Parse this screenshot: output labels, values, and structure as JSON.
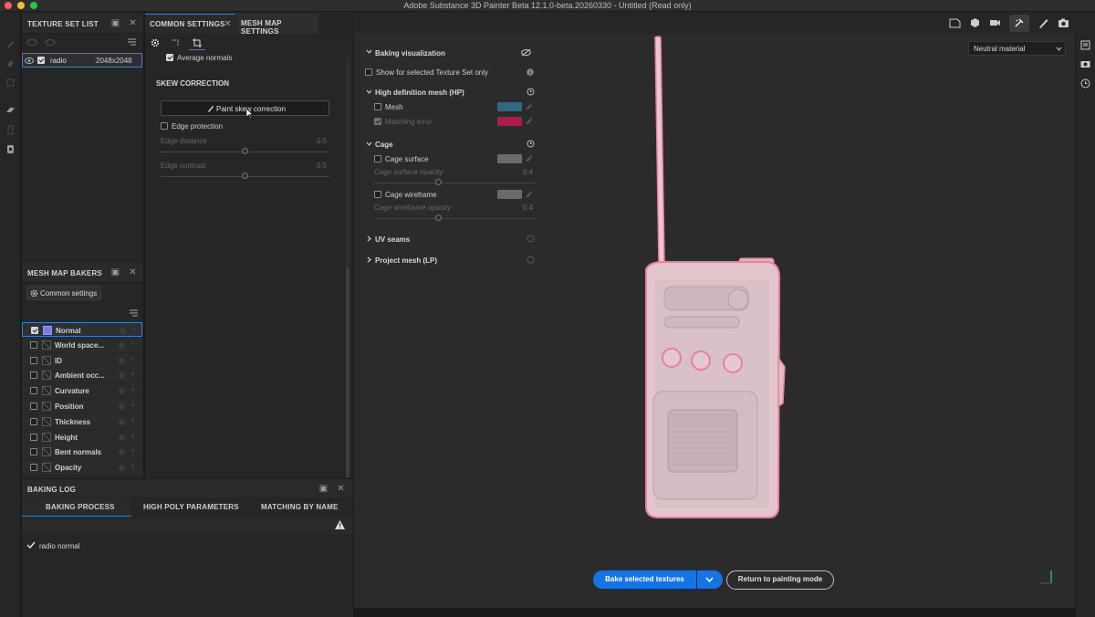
{
  "window": {
    "title": "Adobe Substance 3D Painter Beta 12.1.0-beta.20260330 - Untitled (Read only)",
    "traffic_colors": [
      "#ff5f57",
      "#febc2e",
      "#28c840"
    ]
  },
  "texture_set_list": {
    "title": "TEXTURE SET LIST",
    "item": {
      "name": "radio",
      "resolution": "2048x2048",
      "checked": true
    }
  },
  "settings_tabs": {
    "common": "COMMON SETTINGS",
    "mesh_map": "MESH MAP SETTINGS"
  },
  "common_settings": {
    "average_normals": "Average normals",
    "skew_section": "SKEW CORRECTION",
    "paint_skew_button": "Paint skew correction",
    "edge_protection": "Edge protection",
    "edge_distance": {
      "label": "Edge distance",
      "value": "0.5",
      "fraction": 0.5
    },
    "edge_contrast": {
      "label": "Edge contrast",
      "value": "0.5",
      "fraction": 0.5
    }
  },
  "mesh_map_bakers": {
    "title": "MESH MAP BAKERS",
    "common_settings_button": "Common settings",
    "items": [
      {
        "label": "Normal",
        "checked": true,
        "selected": true
      },
      {
        "label": "World space...",
        "checked": false
      },
      {
        "label": "ID",
        "checked": false
      },
      {
        "label": "Ambient occ...",
        "checked": false
      },
      {
        "label": "Curvature",
        "checked": false
      },
      {
        "label": "Position",
        "checked": false
      },
      {
        "label": "Thickness",
        "checked": false
      },
      {
        "label": "Height",
        "checked": false
      },
      {
        "label": "Bent normals",
        "checked": false
      },
      {
        "label": "Opacity",
        "checked": false
      }
    ]
  },
  "baking_log": {
    "title": "BAKING LOG",
    "tabs": [
      "BAKING PROCESS",
      "HIGH POLY PARAMETERS",
      "MATCHING BY NAME"
    ],
    "entry": "radio normal"
  },
  "baking_viz": {
    "section": "Baking visualization",
    "show_selected": "Show for selected Texture Set only",
    "hd_mesh": "High definition mesh (HP)",
    "mesh": "Mesh",
    "mesh_color": "#2e6b80",
    "matching_error": "Matching error",
    "matching_error_color": "#b01a4a",
    "cage": "Cage",
    "cage_surface": "Cage surface",
    "cage_surface_color": "#6b6b6b",
    "cage_surface_opacity": {
      "label": "Cage surface opacity",
      "value": "0.4",
      "fraction": 0.4
    },
    "cage_wireframe": "Cage wireframe",
    "cage_wireframe_color": "#6b6b6b",
    "cage_wireframe_opacity": {
      "label": "Cage wireframe opacity",
      "value": "0.4",
      "fraction": 0.4
    },
    "uv_seams": "UV seams",
    "project_mesh": "Project mesh (LP)"
  },
  "viewport": {
    "material_select": "Neutral material",
    "bake_button": "Bake selected textures",
    "return_button": "Return to painting mode"
  },
  "colors": {
    "accent": "#1473e6",
    "selection": "#3d7fd1",
    "radio_body": "#e3c7cf",
    "radio_edges": "#e77f9d"
  }
}
